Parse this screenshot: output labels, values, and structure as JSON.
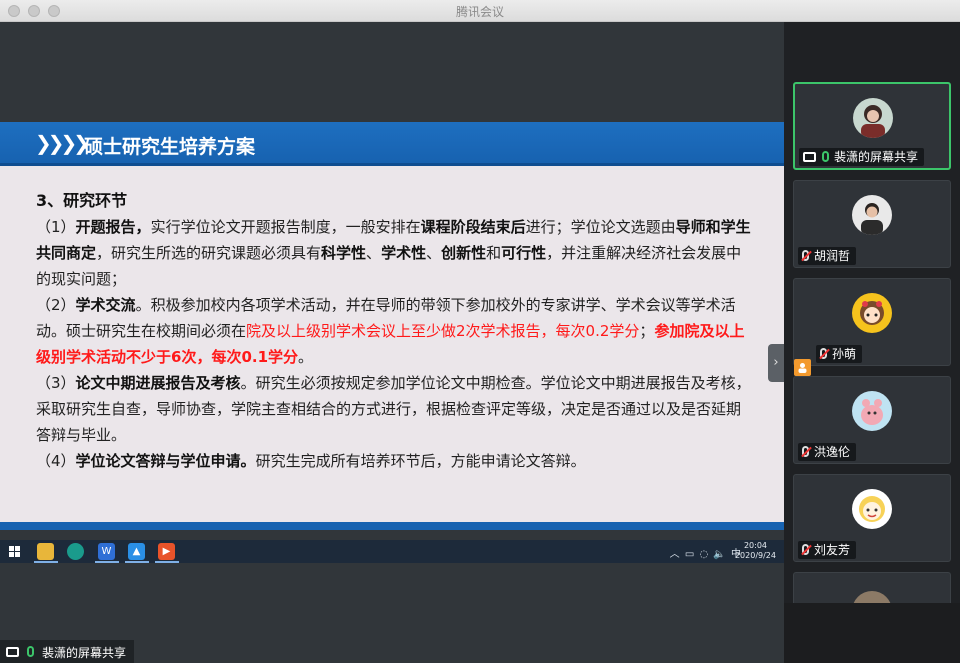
{
  "window": {
    "title": "腾讯会议"
  },
  "slide": {
    "header_chevrons": "❯❯❯❯",
    "title": "硕士研究生培养方案",
    "section_title": "3、研究环节",
    "p1": {
      "num": "（1）",
      "head": "开题报告，",
      "t1": "实行学位论文开题报告制度，一般安排在",
      "b1": "课程阶段结束后",
      "t2": "进行；学位论文选题由",
      "b2": "导师和学生共同商定",
      "t3": "，研究生所选的研究课题必须具有",
      "b3": "科学性",
      "s1": "、",
      "b4": "学术性",
      "s2": "、",
      "b5": "创新性",
      "t4": "和",
      "b6": "可行性",
      "t5": "，并注重解决经济社会发展中的现实问题；"
    },
    "p2": {
      "num": "（2）",
      "head": "学术交流",
      "t1": "。积极参加校内各项学术活动，并在导师的带领下参加校外的专家讲学、学术会议等学术活动。硕士研究生在校期间必须在",
      "r1": "院及以上级别学术会议上至少做2次学术报告，每次0.2学分",
      "t2": "；",
      "r2": "参加院及以上级别学术活动不少于6次，每次0.1学分",
      "t3": "。"
    },
    "p3": {
      "num": "（3）",
      "head": "论文中期进展报告及考核",
      "t1": "。研究生必须按规定参加学位论文中期检查。学位论文中期进展报告及考核，采取研究生自查，导师协查，学院主查相结合的方式进行，根据检查评定等级，决定是否通过以及是否延期答辩与毕业。"
    },
    "p4": {
      "num": "（4）",
      "head": "学位论文答辩与学位申请。",
      "t1": "研究生完成所有培养环节后，方能申请论文答辩。"
    }
  },
  "taskbar": {
    "tray_text": "︿ ▭ ◌ 🔈 中",
    "time": "20:04",
    "date": "2020/9/24"
  },
  "share_bar": {
    "label": "裴潇的屏幕共享"
  },
  "side_handle": "›",
  "participants": [
    {
      "name": "裴潇的屏幕共享",
      "mic": "on"
    },
    {
      "name": "胡润哲",
      "mic": "muted"
    },
    {
      "name": "孙萌",
      "mic": "muted"
    },
    {
      "name": "洪逸伦",
      "mic": "muted"
    },
    {
      "name": "刘友芳",
      "mic": "muted"
    }
  ],
  "colors": {
    "accent_green": "#3cc56a",
    "slide_blue": "#1762b0",
    "highlight_red": "#ff1a1a"
  }
}
